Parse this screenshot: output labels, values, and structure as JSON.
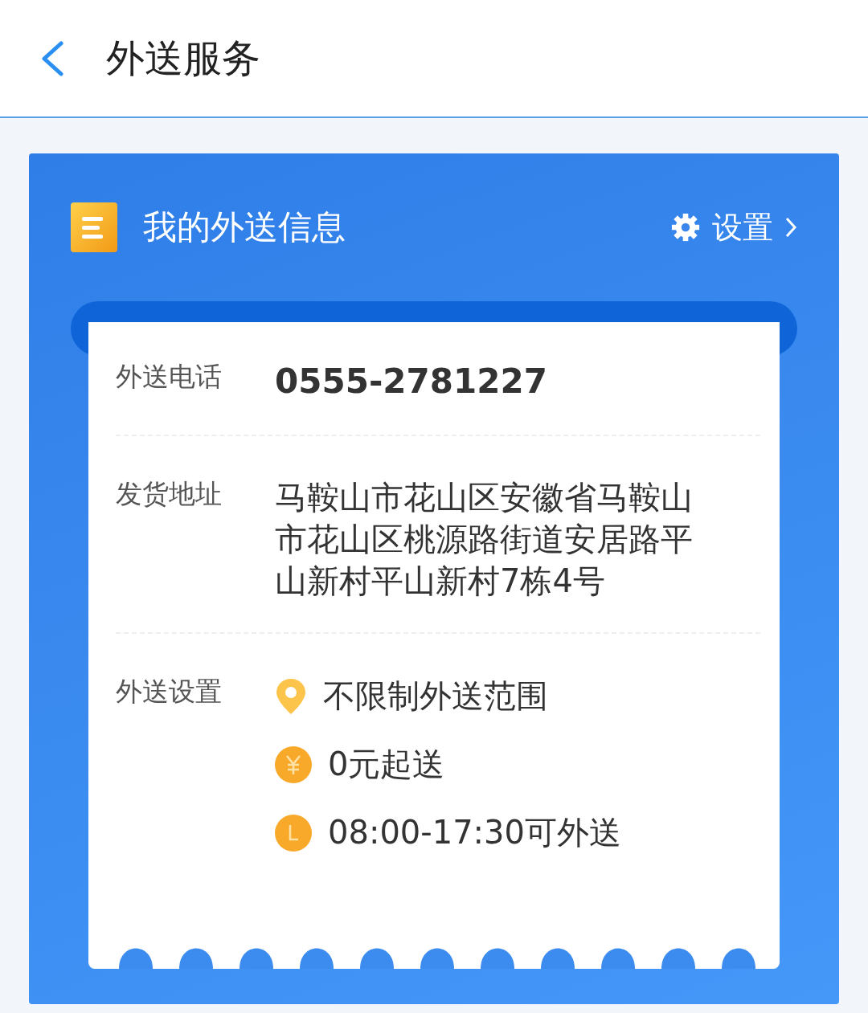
{
  "header": {
    "title": "外送服务"
  },
  "card": {
    "title": "我的外送信息",
    "settings_label": "设置",
    "rows": [
      {
        "kind": "phone",
        "label": "外送电话",
        "value": "0555-2781227"
      },
      {
        "kind": "address",
        "label": "发货地址",
        "value": "马鞍山市花山区安徽省马鞍山市花山区桃源路街道安居路平山新村平山新村7栋4号"
      },
      {
        "kind": "settings",
        "label": "外送设置",
        "items": [
          {
            "kind": "location",
            "text": "不限制外送范围"
          },
          {
            "kind": "price",
            "text": "0元起送"
          },
          {
            "kind": "time",
            "text": "08:00-17:30可外送"
          }
        ]
      }
    ]
  }
}
